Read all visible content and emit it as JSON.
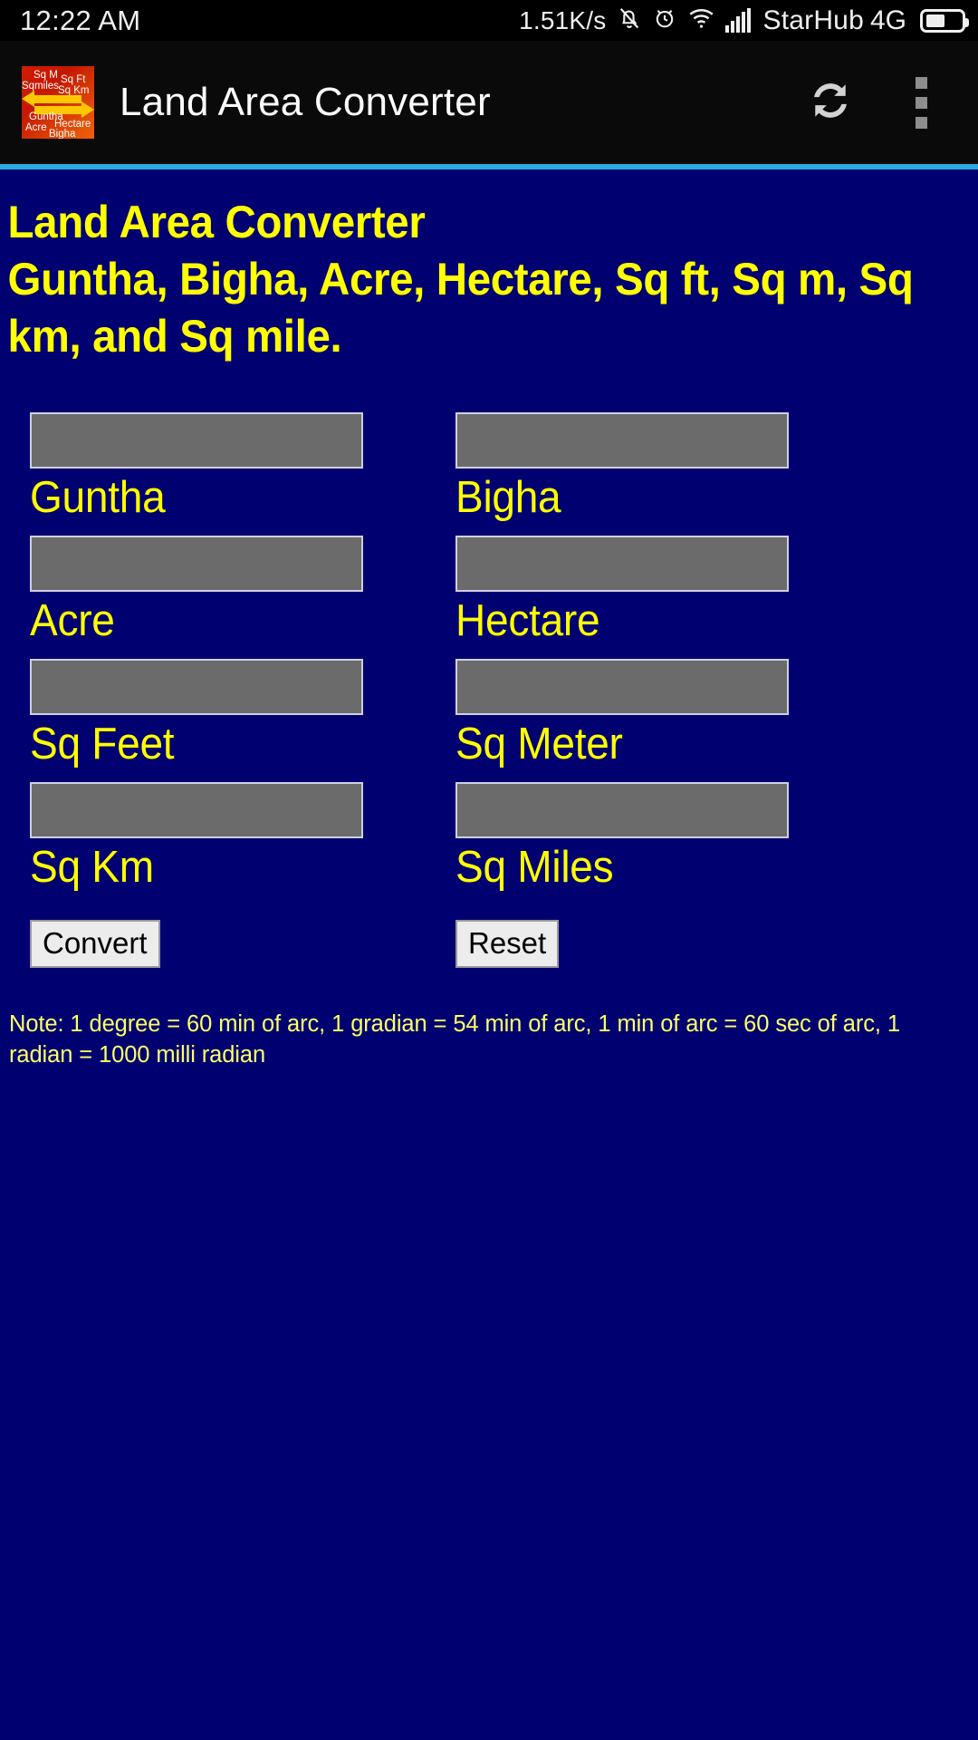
{
  "statusbar": {
    "clock": "12:22 AM",
    "network_speed": "1.51K/s",
    "carrier": "StarHub",
    "network_type": "4G",
    "icons": [
      "bell-off-icon",
      "alarm-icon",
      "wifi-icon",
      "signal-bars-icon",
      "battery-icon"
    ]
  },
  "appbar": {
    "title": "Land Area Converter",
    "logo": {
      "alt": "land-area-converter-logo",
      "labels": [
        "Sq M",
        "Sq Ft",
        "Sqmiles",
        "Sq Km",
        "Guntha",
        "Hectare",
        "Acre",
        "Bigha"
      ]
    },
    "actions": {
      "refresh_label": "refresh-icon",
      "overflow_label": "more-options-icon"
    }
  },
  "content": {
    "heading": "Land Area Converter\nGuntha, Bigha, Acre, Hectare, Sq ft, Sq m, Sq km, and Sq mile.",
    "fields": [
      {
        "label": "Guntha",
        "value": "",
        "placeholder": ""
      },
      {
        "label": "Bigha",
        "value": "",
        "placeholder": ""
      },
      {
        "label": "Acre",
        "value": "",
        "placeholder": ""
      },
      {
        "label": "Hectare",
        "value": "",
        "placeholder": ""
      },
      {
        "label": "Sq Feet",
        "value": "",
        "placeholder": ""
      },
      {
        "label": "Sq Meter",
        "value": "",
        "placeholder": ""
      },
      {
        "label": "Sq Km",
        "value": "",
        "placeholder": ""
      },
      {
        "label": "Sq Miles",
        "value": "",
        "placeholder": ""
      }
    ],
    "buttons": {
      "convert": "Convert",
      "reset": "Reset"
    },
    "note": "Note: 1 degree = 60 min of arc, 1 gradian = 54 min of arc, 1 min of arc = 60 sec of arc, 1 radian = 1000 milli radian"
  },
  "colors": {
    "background": "#000070",
    "accent_text": "#ffff00",
    "divider": "#2aa9e0",
    "input_fill": "#6b6b6b",
    "statusbar": "#000000",
    "appbar": "#0a0a0a"
  }
}
